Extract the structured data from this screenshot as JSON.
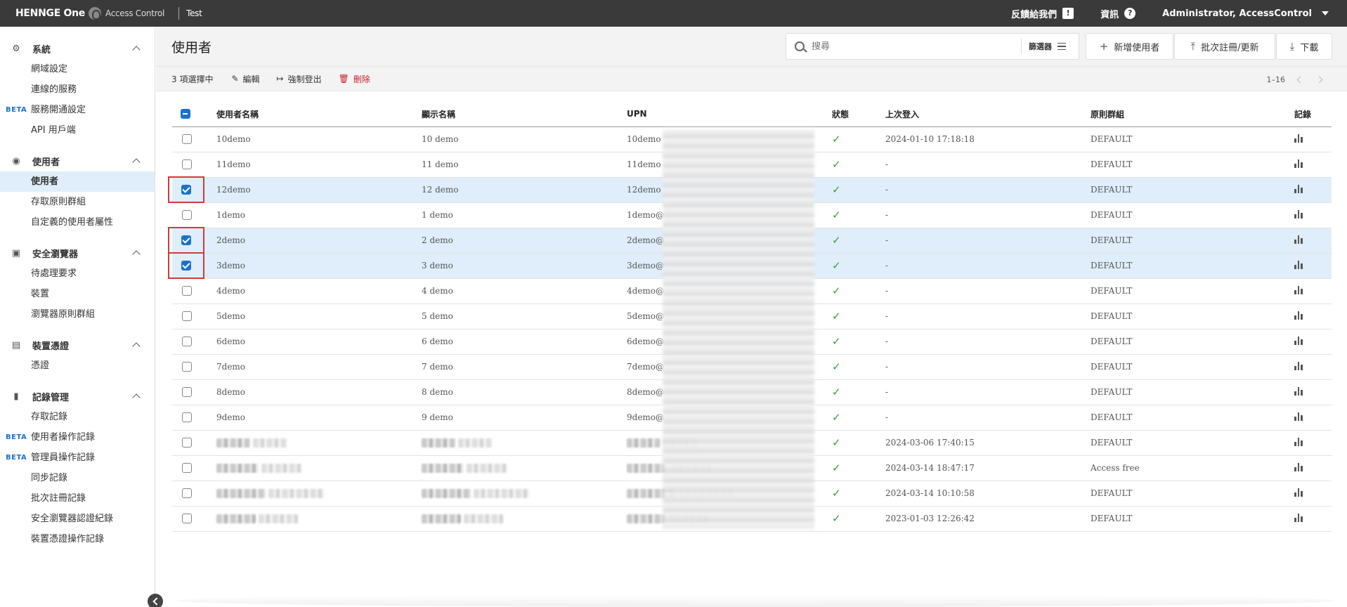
{
  "topbar": {
    "brand": "HENNGE One",
    "product": "Access Control",
    "tenant": "Test",
    "feedback": "反饋給我們",
    "info": "資訊",
    "user": "Administrator, AccessControl"
  },
  "sidebar": {
    "groups": [
      {
        "title": "系統",
        "items": [
          {
            "label": "網域設定"
          },
          {
            "label": "連線的服務"
          },
          {
            "label": "服務開通設定",
            "badge": "BETA"
          },
          {
            "label": "API 用戶端"
          }
        ]
      },
      {
        "title": "使用者",
        "items": [
          {
            "label": "使用者",
            "active": true
          },
          {
            "label": "存取原則群組"
          },
          {
            "label": "自定義的使用者屬性"
          }
        ]
      },
      {
        "title": "安全瀏覽器",
        "items": [
          {
            "label": "待處理要求"
          },
          {
            "label": "裝置"
          },
          {
            "label": "瀏覽器原則群組"
          }
        ]
      },
      {
        "title": "裝置憑證",
        "items": [
          {
            "label": "憑證"
          }
        ]
      },
      {
        "title": "記錄管理",
        "items": [
          {
            "label": "存取記錄"
          },
          {
            "label": "使用者操作記錄",
            "badge": "BETA"
          },
          {
            "label": "管理員操作記錄",
            "badge": "BETA"
          },
          {
            "label": "同步記錄"
          },
          {
            "label": "批次註冊記錄"
          },
          {
            "label": "安全瀏覽器認證紀錄"
          },
          {
            "label": "裝置憑證操作記錄"
          }
        ]
      }
    ]
  },
  "header": {
    "title": "使用者",
    "search_placeholder": "搜尋",
    "filter_label": "篩選器",
    "add_user": "新增使用者",
    "bulk": "批次註冊/更新",
    "download": "下載"
  },
  "actionbar": {
    "selected": "3 項選擇中",
    "edit": "編輯",
    "logout": "強制登出",
    "delete": "刪除",
    "range": "1–16"
  },
  "table": {
    "headers": [
      "使用者名稱",
      "顯示名稱",
      "UPN",
      "狀態",
      "上次登入",
      "原則群組",
      "記錄"
    ],
    "rows": [
      {
        "user": "10demo",
        "display": "10 demo",
        "upn": "10demo",
        "last": "2024-01-10 17:18:18",
        "group": "DEFAULT",
        "checked": false
      },
      {
        "user": "11demo",
        "display": "11 demo",
        "upn": "11demo",
        "last": "-",
        "group": "DEFAULT",
        "checked": false
      },
      {
        "user": "12demo",
        "display": "12 demo",
        "upn": "12demo",
        "last": "-",
        "group": "DEFAULT",
        "checked": true
      },
      {
        "user": "1demo",
        "display": "1 demo",
        "upn": "1demo@",
        "last": "-",
        "group": "DEFAULT",
        "checked": false
      },
      {
        "user": "2demo",
        "display": "2 demo",
        "upn": "2demo@",
        "last": "-",
        "group": "DEFAULT",
        "checked": true
      },
      {
        "user": "3demo",
        "display": "3 demo",
        "upn": "3demo@",
        "last": "-",
        "group": "DEFAULT",
        "checked": true
      },
      {
        "user": "4demo",
        "display": "4 demo",
        "upn": "4demo@",
        "last": "-",
        "group": "DEFAULT",
        "checked": false
      },
      {
        "user": "5demo",
        "display": "5 demo",
        "upn": "5demo@",
        "last": "-",
        "group": "DEFAULT",
        "checked": false
      },
      {
        "user": "6demo",
        "display": "6 demo",
        "upn": "6demo@",
        "last": "-",
        "group": "DEFAULT",
        "checked": false
      },
      {
        "user": "7demo",
        "display": "7 demo",
        "upn": "7demo@",
        "last": "-",
        "group": "DEFAULT",
        "checked": false
      },
      {
        "user": "8demo",
        "display": "8 demo",
        "upn": "8demo@",
        "last": "-",
        "group": "DEFAULT",
        "checked": false
      },
      {
        "user": "9demo",
        "display": "9 demo",
        "upn": "9demo@",
        "last": "-",
        "group": "DEFAULT",
        "checked": false
      },
      {
        "user": "",
        "display": "",
        "upn": "",
        "last": "2024-03-06 17:40:15",
        "group": "DEFAULT",
        "checked": false,
        "blurred": true
      },
      {
        "user": "",
        "display": "",
        "upn": "",
        "last": "2024-03-14 18:47:17",
        "group": "Access free",
        "checked": false,
        "blurred": true
      },
      {
        "user": "",
        "display": "",
        "upn": "",
        "last": "2024-03-14 10:10:58",
        "group": "DEFAULT",
        "checked": false,
        "blurred": true
      },
      {
        "user": "",
        "display": "",
        "upn": "",
        "last": "2023-01-03 12:26:42",
        "group": "DEFAULT",
        "checked": false,
        "blurred": true
      }
    ]
  },
  "colors": {
    "accent": "#1a73c8",
    "danger": "#c8202a",
    "success": "#3a9c3a",
    "topbar": "#3a3a3a",
    "selected_row": "#dfeefa"
  }
}
